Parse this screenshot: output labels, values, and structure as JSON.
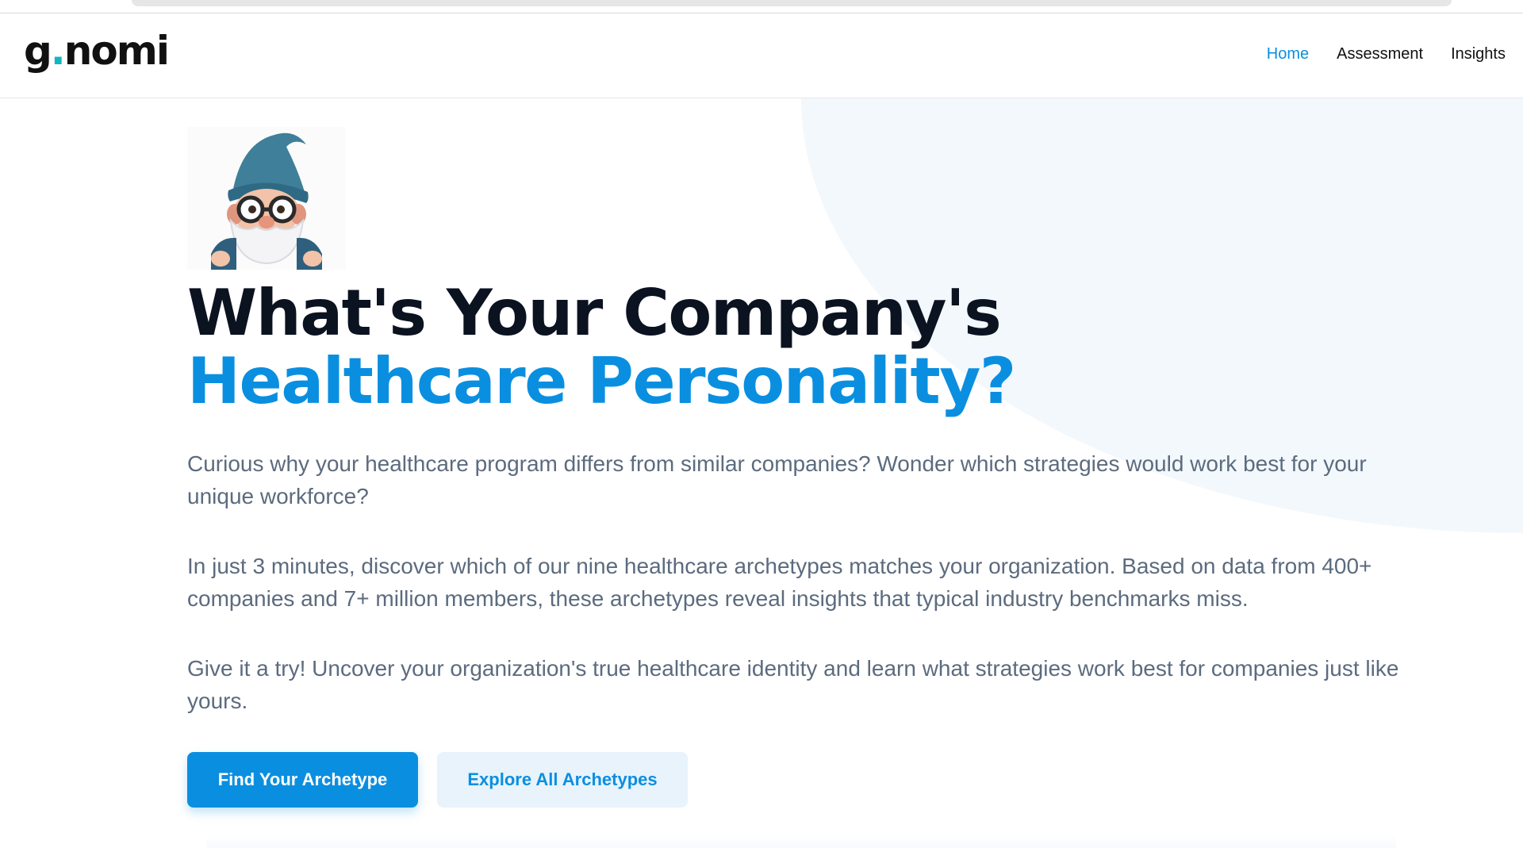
{
  "header": {
    "logo": {
      "part1": "g",
      "dot": ".",
      "part2": "nomi"
    },
    "nav": [
      {
        "label": "Home",
        "active": true
      },
      {
        "label": "Assessment",
        "active": false
      },
      {
        "label": "Insights",
        "active": false
      }
    ]
  },
  "hero": {
    "mascot_icon": "gnome-wizard-mascot-icon",
    "title_part1": "What's Your Company's ",
    "title_accent": "Healthcare Personality?",
    "paragraphs": [
      "Curious why your healthcare program differs from similar companies? Wonder which strategies would work best for your unique workforce?",
      "In just 3 minutes, discover which of our nine healthcare archetypes matches your organization. Based on data from 400+ companies and 7+ million members, these archetypes reveal insights that typical industry benchmarks miss.",
      "Give it a try! Uncover your organization's true healthcare identity and learn what strategies work best for companies just like yours."
    ],
    "primary_button": "Find Your Archetype",
    "secondary_button": "Explore All Archetypes"
  },
  "colors": {
    "accent": "#0a8fe0",
    "logo_dot": "#12b5c3",
    "body_text": "#5c6b7e",
    "heading": "#0b1220",
    "hero_bg": "#f3f8fd"
  }
}
